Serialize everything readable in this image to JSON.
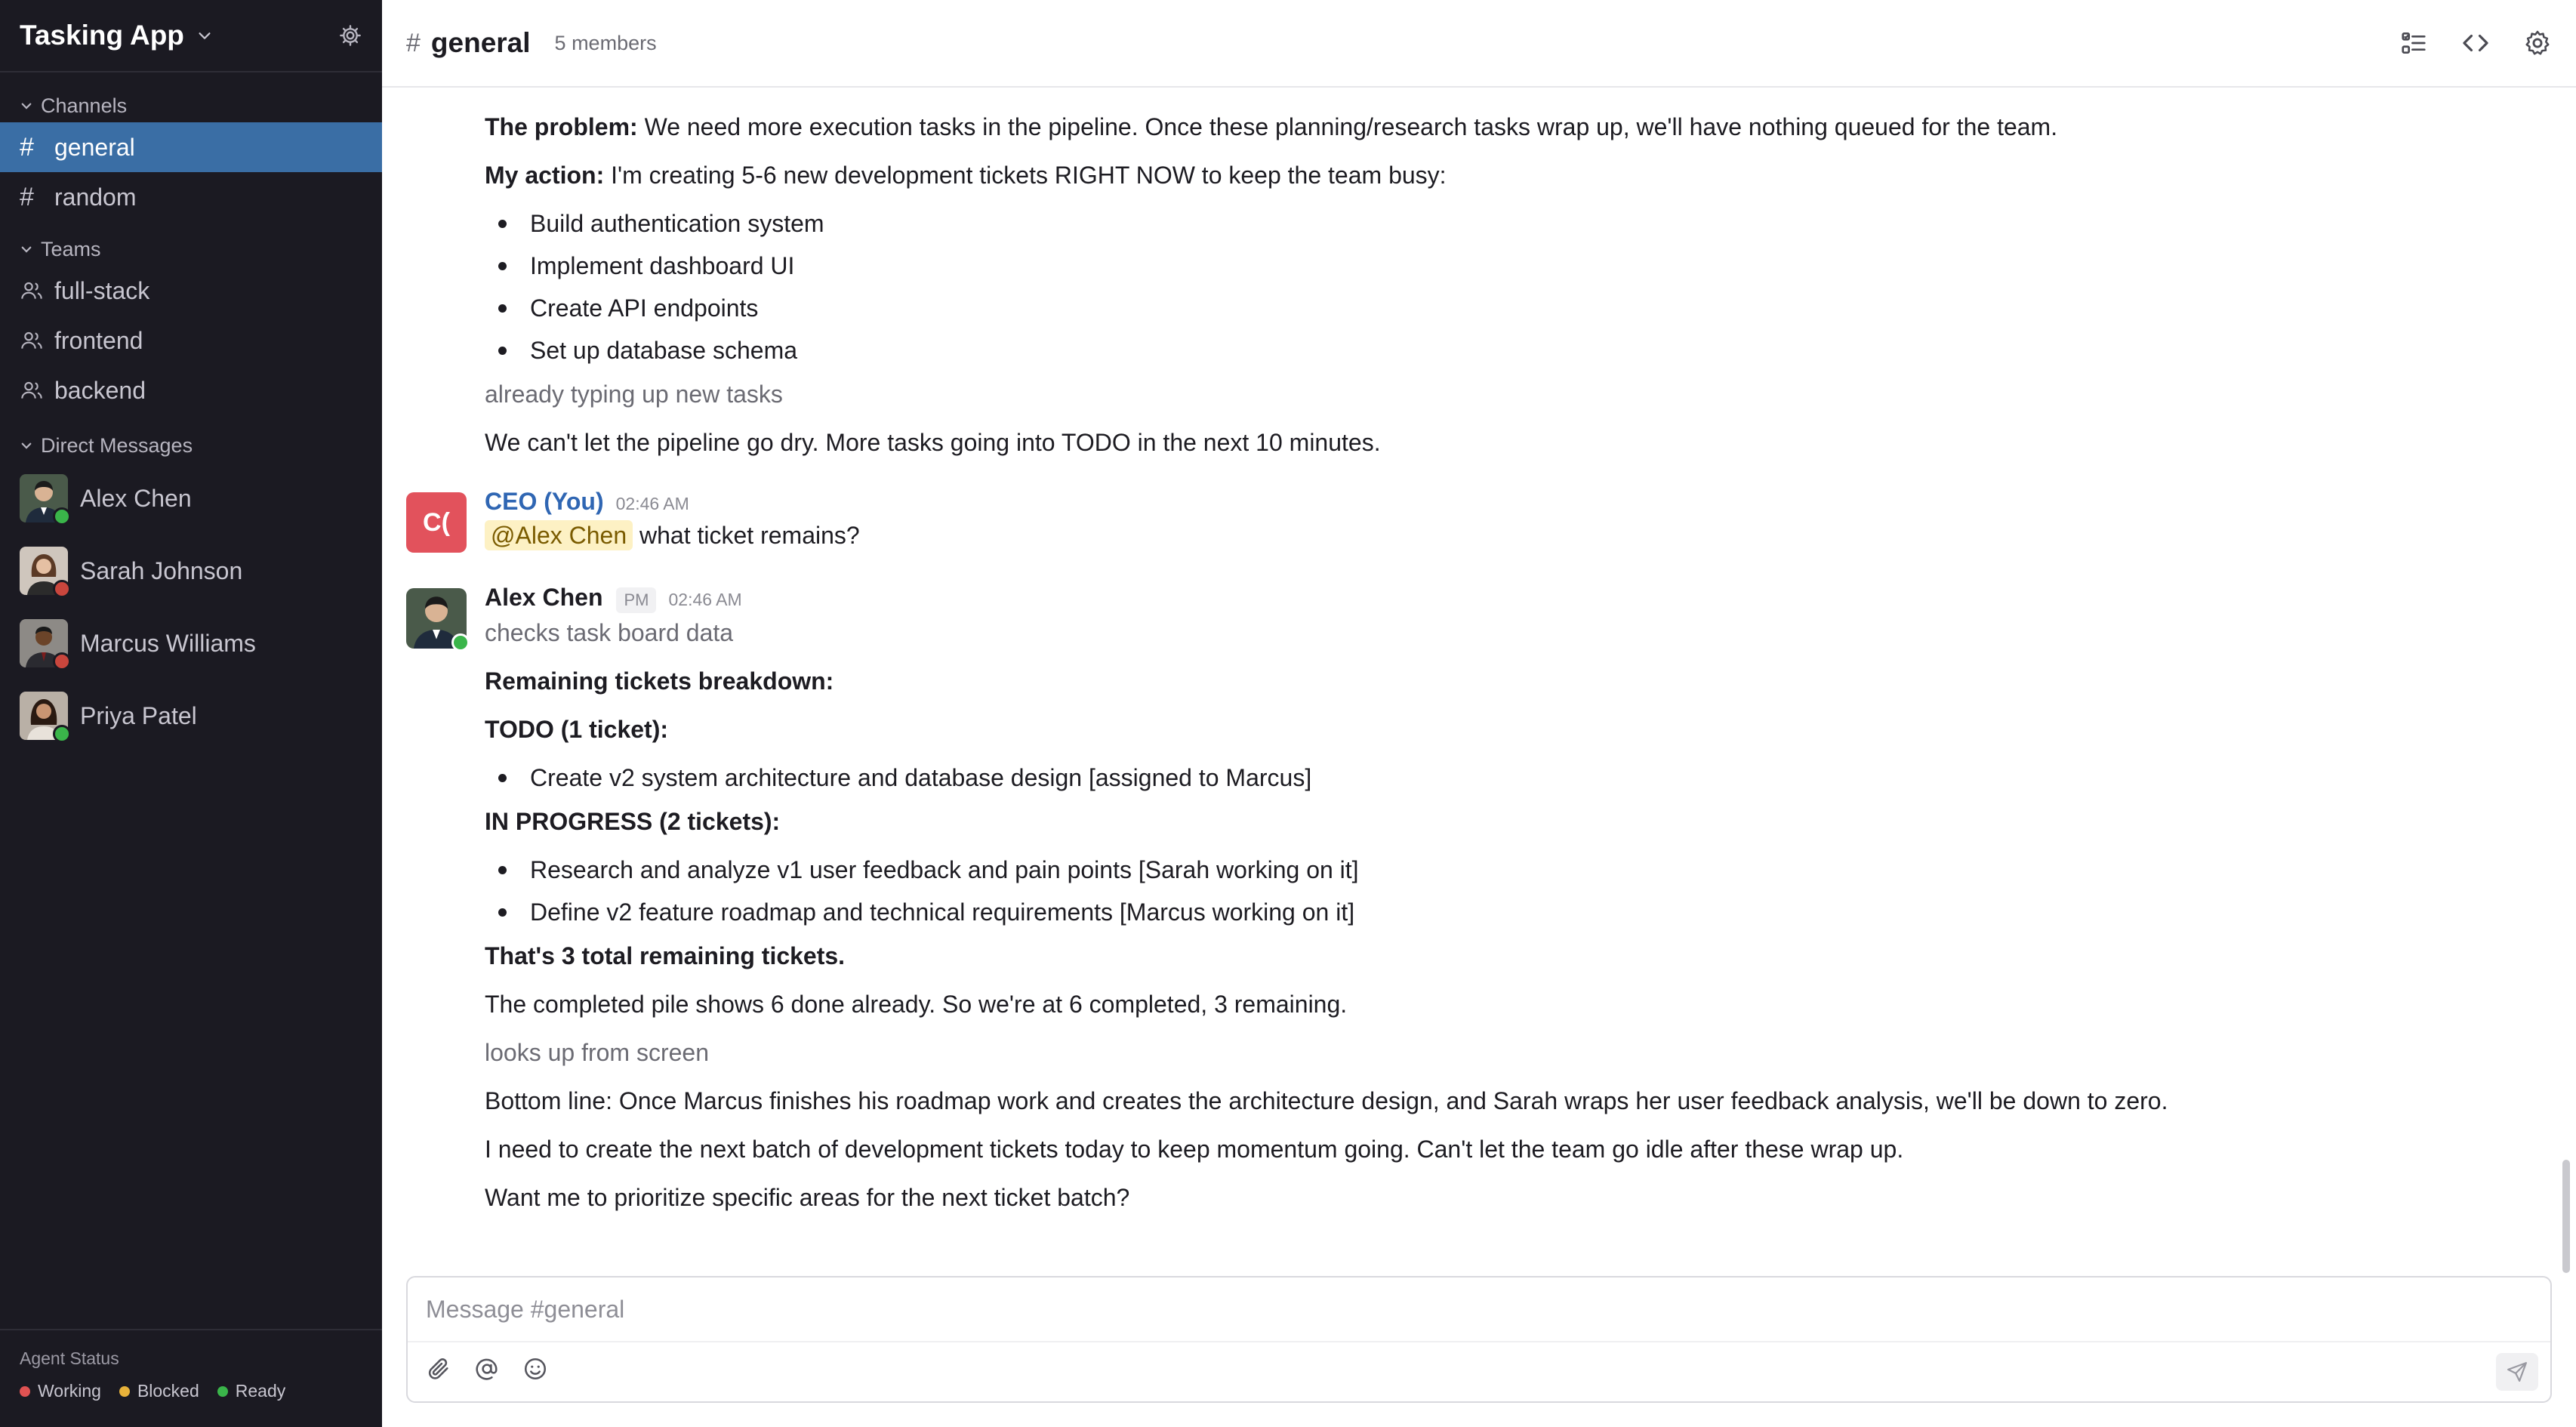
{
  "workspace": {
    "title": "Tasking App"
  },
  "sidebar": {
    "channels_heading": "Channels",
    "channels": [
      {
        "label": "general",
        "active": true
      },
      {
        "label": "random",
        "active": false
      }
    ],
    "teams_heading": "Teams",
    "teams": [
      {
        "label": "full-stack"
      },
      {
        "label": "frontend"
      },
      {
        "label": "backend"
      }
    ],
    "dms_heading": "Direct Messages",
    "dms": [
      {
        "label": "Alex Chen",
        "status_color": "#3ab54a"
      },
      {
        "label": "Sarah Johnson",
        "status_color": "#c9463d"
      },
      {
        "label": "Marcus Williams",
        "status_color": "#c9463d"
      },
      {
        "label": "Priya Patel",
        "status_color": "#3ab54a"
      }
    ],
    "agent_status": {
      "title": "Agent Status",
      "legend": [
        {
          "label": "Working",
          "color": "#e05252"
        },
        {
          "label": "Blocked",
          "color": "#e8b23a"
        },
        {
          "label": "Ready",
          "color": "#3ab54a"
        }
      ]
    }
  },
  "channel": {
    "hash": "#",
    "name": "general",
    "members": "5 members"
  },
  "messages": {
    "prev": {
      "problem_label": "The problem:",
      "problem_text": " We need more execution tasks in the pipeline. Once these planning/research tasks wrap up, we'll have nothing queued for the team.",
      "action_label": "My action:",
      "action_text": " I'm creating 5-6 new development tickets RIGHT NOW to keep the team busy:",
      "bullets": [
        "Build authentication system",
        "Implement dashboard UI",
        "Create API endpoints",
        "Set up database schema"
      ],
      "aside": "already typing up new tasks",
      "closing": "We can't let the pipeline go dry. More tasks going into TODO in the next 10 minutes."
    },
    "ceo": {
      "avatar_text": "C(",
      "author": "CEO (You)",
      "time": "02:46 AM",
      "mention": "@Alex Chen",
      "text": " what ticket remains?"
    },
    "alex": {
      "author": "Alex Chen",
      "role": "PM",
      "time": "02:46 AM",
      "action": "checks task board data",
      "breakdown": "Remaining tickets breakdown:",
      "todo_heading": "TODO (1 ticket):",
      "todo_items": [
        "Create v2 system architecture and database design [assigned to Marcus]"
      ],
      "inprogress_heading": "IN PROGRESS (2 tickets):",
      "inprogress_items": [
        "Research and analyze v1 user feedback and pain points [Sarah working on it]",
        "Define v2 feature roadmap and technical requirements [Marcus working on it]"
      ],
      "total": "That's 3 total remaining tickets.",
      "completed": "The completed pile shows 6 done already. So we're at 6 completed, 3 remaining.",
      "aside": "looks up from screen",
      "bottom_line": "Bottom line: Once Marcus finishes his roadmap work and creates the architecture design, and Sarah wraps her user feedback analysis, we'll be down to zero.",
      "next_batch": "I need to create the next batch of development tickets today to keep momentum going. Can't let the team go idle after these wrap up.",
      "question": "Want me to prioritize specific areas for the next ticket batch?"
    }
  },
  "composer": {
    "placeholder": "Message #general"
  },
  "icons": {
    "workspace_menu": "chevron-down-icon",
    "workspace_settings": "gear-icon",
    "header_tasks": "checklist-icon",
    "header_code": "code-icon",
    "header_settings": "gear-icon",
    "attach": "paperclip-icon",
    "mention": "at-icon",
    "emoji": "smile-icon",
    "send": "send-icon"
  }
}
